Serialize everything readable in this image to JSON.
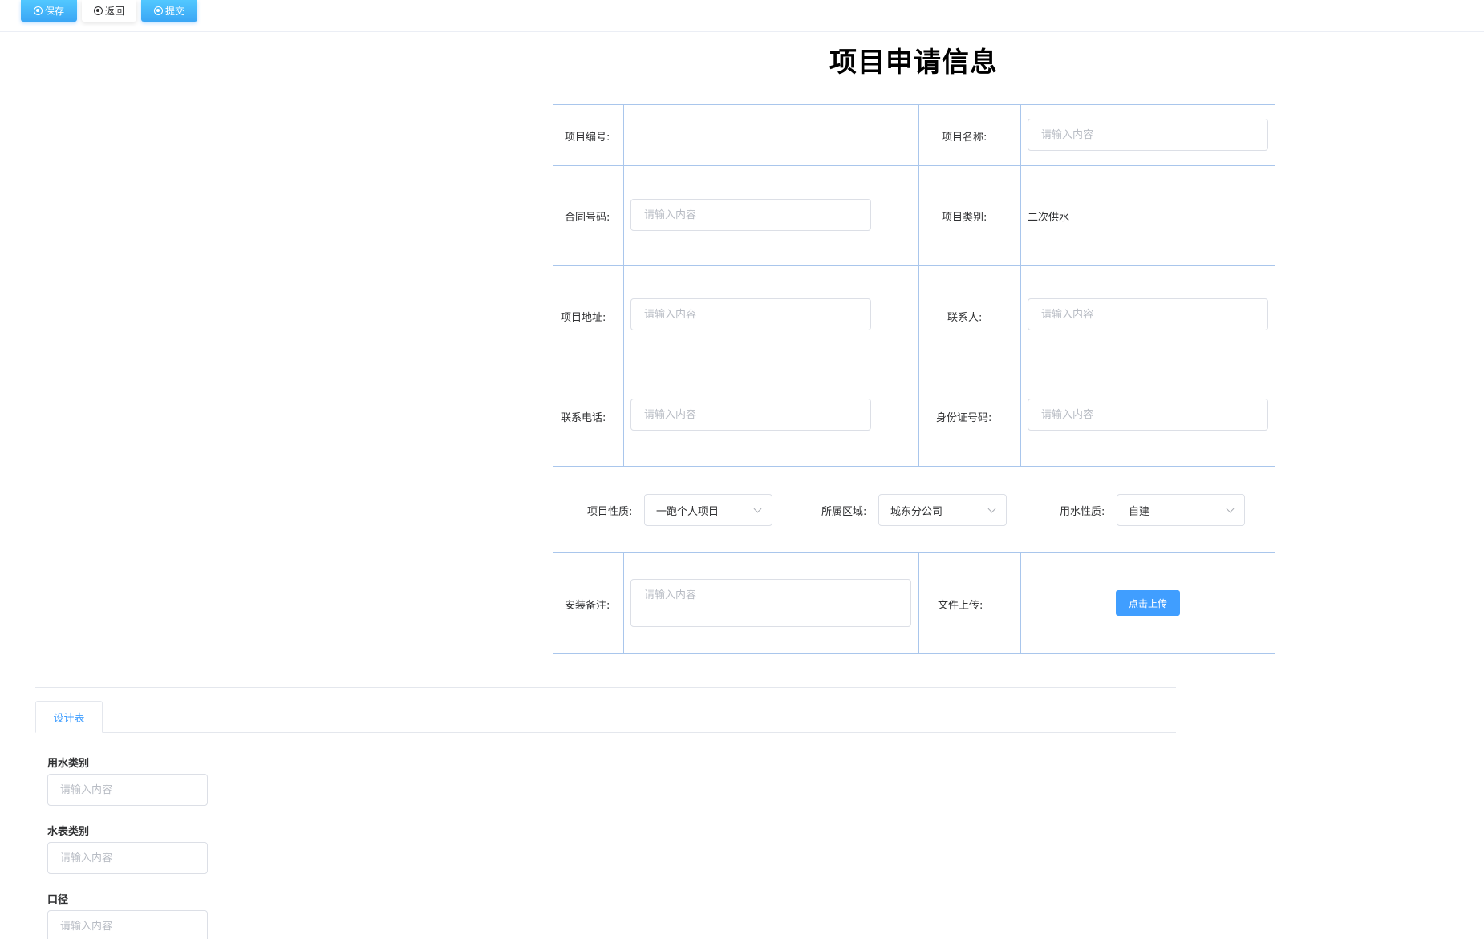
{
  "toolbar": {
    "save_label": "保存",
    "back_label": "返回",
    "submit_label": "提交"
  },
  "page_title": "项目申请信息",
  "form": {
    "project_no_label": "项目编号:",
    "project_no_value": "",
    "project_name_label": "项目名称:",
    "project_name_placeholder": "请输入内容",
    "contract_no_label": "合同号码:",
    "contract_no_placeholder": "请输入内容",
    "project_category_label": "项目类别:",
    "project_category_value": "二次供水",
    "address_label": "项目地址:",
    "address_placeholder": "请输入内容",
    "contact_label": "联系人:",
    "contact_placeholder": "请输入内容",
    "phone_label": "联系电话:",
    "phone_placeholder": "请输入内容",
    "id_label": "身份证号码:",
    "id_placeholder": "请输入内容",
    "nature_label": "项目性质:",
    "nature_value": "一跑个人项目",
    "region_label": "所属区域:",
    "region_value": "城东分公司",
    "water_nature_label": "用水性质:",
    "water_nature_value": "自建",
    "remarks_label": "安装备注:",
    "remarks_placeholder": "请输入内容",
    "upload_label": "文件上传:",
    "upload_button": "点击上传"
  },
  "tabs": [
    {
      "label": "设计表",
      "active": true
    }
  ],
  "design": {
    "water_category_label": "用水类别",
    "water_category_placeholder": "请输入内容",
    "meter_category_label": "水表类别",
    "meter_category_placeholder": "请输入内容",
    "caliber_label": "口径",
    "caliber_placeholder": "请输入内容"
  },
  "colors": {
    "primary": "#409eff",
    "table_border": "#a9c6ec"
  }
}
